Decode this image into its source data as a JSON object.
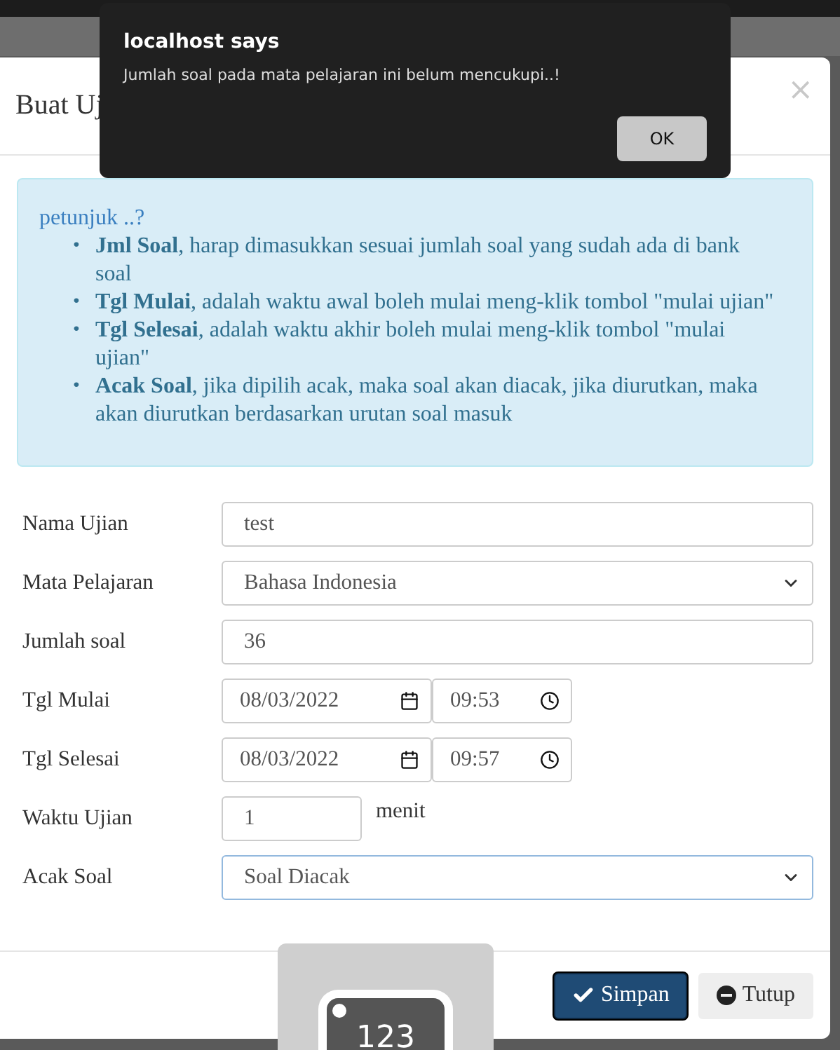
{
  "modal": {
    "title": "Buat Uj",
    "close": "×"
  },
  "hint": {
    "title": "petunjuk ..?",
    "marker": "•",
    "items": [
      "**Jml Soal**, harap dimasukkan sesuai jumlah soal yang sudah ada di bank soal",
      "**Tgl Mulai**, adalah waktu awal boleh mulai meng-klik tombol \"mulai ujian\"",
      "**Tgl Selesai**, adalah waktu akhir boleh mulai meng-klik tombol \"mulai ujian\"",
      "**Acak Soal**, jika dipilih acak, maka soal akan diacak, jika diurutkan, maka akan diurutkan berdasarkan urutan soal masuk"
    ]
  },
  "form": {
    "fields": [
      {
        "label": "Nama Ujian",
        "kind": "text",
        "value": "test",
        "focused": false
      },
      {
        "label": "Mata Pelajaran",
        "kind": "select",
        "value": "Bahasa Indonesia",
        "focused": false
      },
      {
        "label": "Jumlah soal",
        "kind": "text",
        "value": "36",
        "focused": false
      },
      {
        "label": "Tgl Mulai",
        "kind": "datetime",
        "date": "08/03/2022",
        "time": "09:53",
        "focused": false
      },
      {
        "label": "Tgl Selesai",
        "kind": "datetime",
        "date": "08/03/2022",
        "time": "09:57",
        "focused": false
      },
      {
        "label": "Waktu Ujian",
        "kind": "short",
        "value": "1",
        "suffix": "menit",
        "focused": false
      },
      {
        "label": "Acak Soal",
        "kind": "select",
        "value": "Soal Diacak",
        "focused": true
      }
    ]
  },
  "footer": {
    "buttons": [
      {
        "label": "Simpan",
        "kind": "primary"
      },
      {
        "label": "Tutup",
        "kind": "default"
      }
    ]
  },
  "keypad_widget": {
    "label": "123"
  },
  "alert": {
    "title": "localhost says",
    "message": "Jumlah soal pada mata pelajaran ini belum mencukupi..!",
    "button": "OK"
  }
}
